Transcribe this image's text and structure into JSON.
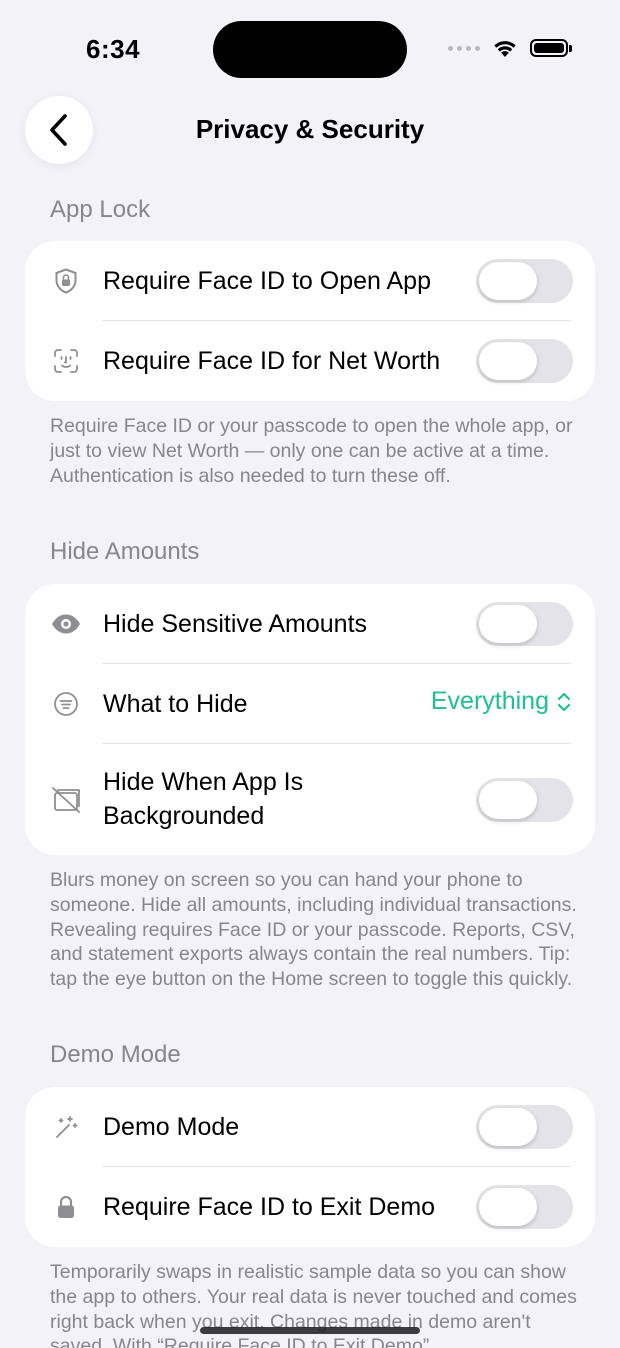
{
  "status_bar": {
    "time": "6:34"
  },
  "nav": {
    "title": "Privacy & Security"
  },
  "sections": {
    "app_lock": {
      "header": "App Lock",
      "rows": [
        {
          "label": "Require Face ID to Open App",
          "icon": "shield-lock-icon",
          "toggle_on": false
        },
        {
          "label": "Require Face ID for Net Worth",
          "icon": "face-id-icon",
          "toggle_on": false
        }
      ],
      "footnote": "Require Face ID or your passcode to open the whole app, or just to view Net Worth — only one can be active at a time. Authentication is also needed to turn these off."
    },
    "hide_amounts": {
      "header": "Hide Amounts",
      "rows": [
        {
          "label": "Hide Sensitive Amounts",
          "icon": "eye-icon",
          "toggle_on": false
        },
        {
          "label": "What to Hide",
          "icon": "filter-icon",
          "value": "Everything"
        },
        {
          "label_line1": "Hide When App Is",
          "label_line2": "Backgrounded",
          "icon": "hidden-window-icon",
          "toggle_on": false
        }
      ],
      "footnote": "Blurs money on screen so you can hand your phone to someone. Hide all amounts, including individual transactions. Revealing requires Face ID or your passcode. Reports, CSV, and statement exports always contain the real numbers. Tip: tap the eye button on the Home screen to toggle this quickly."
    },
    "demo_mode": {
      "header": "Demo Mode",
      "rows": [
        {
          "label": "Demo Mode",
          "icon": "magic-wand-icon",
          "toggle_on": false
        },
        {
          "label": "Require Face ID to Exit Demo",
          "icon": "lock-icon",
          "toggle_on": false
        }
      ],
      "footnote": "Temporarily swaps in realistic sample data so you can show the app to others. Your real data is never touched and comes right back when you exit. Changes made in demo aren't saved. With “Require Face ID to Exit Demo”"
    }
  },
  "colors": {
    "accent": "#1fbf93",
    "background": "#f2f2f7",
    "secondary_text": "#86868b"
  }
}
